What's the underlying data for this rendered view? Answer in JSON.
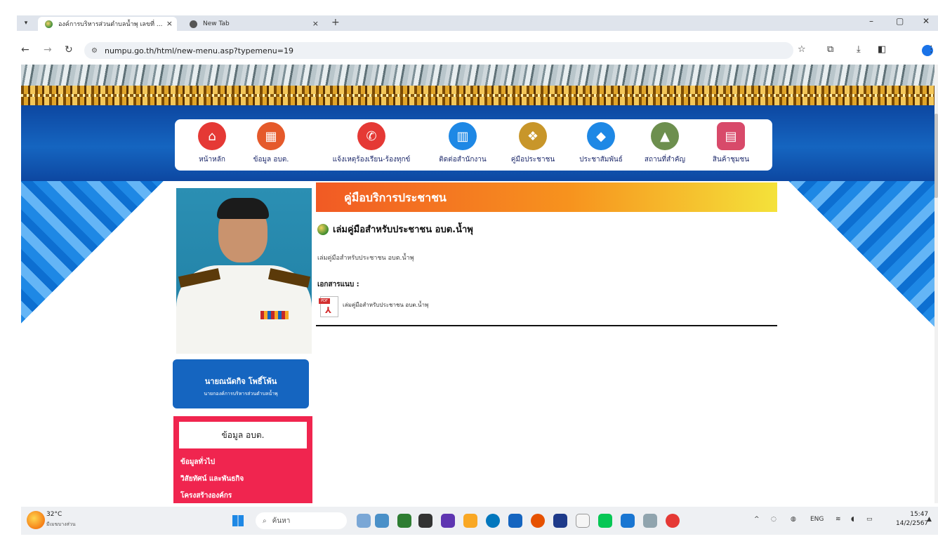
{
  "browser": {
    "tabs": [
      {
        "label": "องค์การบริหารส่วนตำบลน้ำพุ เลขที่ ...",
        "active": true
      },
      {
        "label": "New Tab",
        "active": false
      }
    ],
    "new_tab_symbol": "+",
    "close_symbol": "×",
    "window_controls": {
      "minimize": "–",
      "restore": "▢",
      "close": "✕"
    },
    "url": "numpu.go.th/html/new-menu.asp?typemenu=19",
    "nav": {
      "back": "←",
      "forward": "→",
      "reload": "↻"
    },
    "toolbar_icons": [
      "star-icon",
      "extensions-icon",
      "download-icon",
      "sidepanel-icon",
      "profile-icon",
      "more-icon"
    ]
  },
  "menu": {
    "items": [
      {
        "label": "หน้าหลัก",
        "icon": "home-icon",
        "color": "#e53935"
      },
      {
        "label": "ข้อมูล อบต.",
        "icon": "building-icon",
        "color": "#e55a2b"
      },
      {
        "label": "แจ้งเหตุร้องเรียน-ร้องทุกข์",
        "icon": "phone-icon",
        "color": "#e53935"
      },
      {
        "label": "ติดต่อสำนักงาน",
        "icon": "office-icon",
        "color": "#1e88e5"
      },
      {
        "label": "คู่มือประชาชน",
        "icon": "manual-icon",
        "color": "#c8962a"
      },
      {
        "label": "ประชาสัมพันธ์",
        "icon": "announce-icon",
        "color": "#1e88e5"
      },
      {
        "label": "สถานที่สำคัญ",
        "icon": "place-icon",
        "color": "#6d8f4e"
      },
      {
        "label": "สินค้าชุมชน",
        "icon": "shop-icon",
        "color": "#d84a6a"
      }
    ]
  },
  "profile": {
    "name": "นายณนัดกิจ โพธิ์โพ้น",
    "position": "นายกองค์การบริหารส่วนตำบลน้ำพุ"
  },
  "info_box": {
    "title": "ข้อมูล อบต.",
    "links": [
      "ข้อมูลทั่วไป",
      "วิสัยทัศน์ และพันธกิจ",
      "โครงสร้างองค์กร"
    ]
  },
  "content": {
    "heading": "คู่มือบริการประชาชน",
    "doc_title": "เล่มคู่มือสำหรับประชาชน อบต.น้ำพุ",
    "description": "เล่มคู่มือสำหรับประชาชน อบต.น้ำพุ",
    "attachment_label": "เอกสารแนบ :",
    "pdf_tag": "PDF",
    "attachment_link": "เล่มคู่มือสำหรับประชาชน อบต.น้ำพุ"
  },
  "taskbar": {
    "weather_temp": "32°C",
    "weather_desc": "มีเมฆบางส่วน",
    "search_placeholder": "ค้นหา",
    "lang": "ENG",
    "time": "15:47",
    "date": "14/2/2567"
  }
}
